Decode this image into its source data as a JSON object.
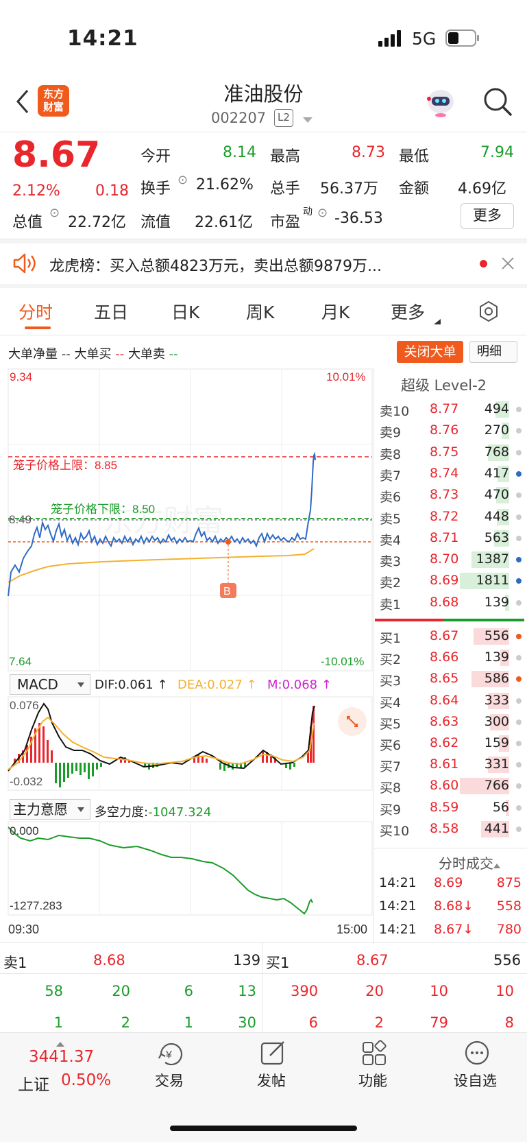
{
  "status": {
    "time": "14:21",
    "network": "5G"
  },
  "header": {
    "logo": "东方\n财富",
    "name": "准油股份",
    "code": "002207",
    "level": "L2"
  },
  "quote": {
    "price": "8.67",
    "change_pct": "2.12%",
    "change": "0.18",
    "open_label": "今开",
    "open": "8.14",
    "high_label": "最高",
    "high": "8.73",
    "low_label": "最低",
    "low": "7.94",
    "turnover_label": "换手",
    "turnover": "21.62%",
    "volume_label": "总手",
    "volume": "56.37万",
    "amount_label": "金额",
    "amount": "4.69亿",
    "mktcap_label": "总值",
    "mktcap": "22.72亿",
    "float_label": "流值",
    "float": "22.61亿",
    "pe_label": "市盈",
    "pe_sup": "动",
    "pe": "-36.53",
    "more": "更多"
  },
  "notice": {
    "text": "龙虎榜：买入总额4823万元，卖出总额9879万..."
  },
  "tabs": [
    "分时",
    "五日",
    "日K",
    "周K",
    "月K",
    "更多"
  ],
  "bigorder": {
    "net": "大单净量",
    "buy": "大单买",
    "sell": "大单卖",
    "close_btn": "关闭大单",
    "detail_btn": "明细"
  },
  "chart": {
    "y_top": "9.34",
    "y_top_pct": "10.01%",
    "y_bottom": "7.64",
    "y_bottom_pct": "-10.01%",
    "y_prev": "8.49",
    "cage_upper": "笼子价格上限：8.85",
    "cage_lower": "笼子价格下限：8.50",
    "marker": "B",
    "watermark": "东方财富",
    "time_start": "09:30",
    "time_end": "15:00"
  },
  "macd": {
    "label": "MACD",
    "dif": "DIF:0.061 ↑",
    "dea": "DEA:0.027 ↑",
    "m": "M:0.068 ↑",
    "top": "0.076",
    "bottom": "-0.032"
  },
  "main_force": {
    "label": "主力意愿",
    "value_label": "多空力度:",
    "value": "-1047.324",
    "top": "0.000",
    "bottom": "-1277.283"
  },
  "level2": {
    "title": "超级 Level-2",
    "asks": [
      {
        "label": "卖10",
        "price": "8.77",
        "vol": "494"
      },
      {
        "label": "卖9",
        "price": "8.76",
        "vol": "270"
      },
      {
        "label": "卖8",
        "price": "8.75",
        "vol": "768"
      },
      {
        "label": "卖7",
        "price": "8.74",
        "vol": "417"
      },
      {
        "label": "卖6",
        "price": "8.73",
        "vol": "470"
      },
      {
        "label": "卖5",
        "price": "8.72",
        "vol": "448"
      },
      {
        "label": "卖4",
        "price": "8.71",
        "vol": "563"
      },
      {
        "label": "卖3",
        "price": "8.70",
        "vol": "1387"
      },
      {
        "label": "卖2",
        "price": "8.69",
        "vol": "1811"
      },
      {
        "label": "卖1",
        "price": "8.68",
        "vol": "139"
      }
    ],
    "bids": [
      {
        "label": "买1",
        "price": "8.67",
        "vol": "556"
      },
      {
        "label": "买2",
        "price": "8.66",
        "vol": "139"
      },
      {
        "label": "买3",
        "price": "8.65",
        "vol": "586"
      },
      {
        "label": "买4",
        "price": "8.64",
        "vol": "333"
      },
      {
        "label": "买5",
        "price": "8.63",
        "vol": "300"
      },
      {
        "label": "买6",
        "price": "8.62",
        "vol": "159"
      },
      {
        "label": "买7",
        "price": "8.61",
        "vol": "331"
      },
      {
        "label": "买8",
        "price": "8.60",
        "vol": "766"
      },
      {
        "label": "买9",
        "price": "8.59",
        "vol": "56"
      },
      {
        "label": "买10",
        "price": "8.58",
        "vol": "441"
      }
    ],
    "trades_title": "分时成交",
    "trades": [
      {
        "time": "14:21",
        "price": "8.69",
        "vol": "875"
      },
      {
        "time": "14:21",
        "price": "8.68↓",
        "vol": "558"
      },
      {
        "time": "14:21",
        "price": "8.67↓",
        "vol": "780"
      }
    ]
  },
  "queue": {
    "ask_label": "卖1",
    "ask_price": "8.68",
    "ask_vol": "139",
    "bid_label": "买1",
    "bid_price": "8.67",
    "bid_vol": "556",
    "ask_rows": [
      [
        "58",
        "20",
        "6",
        "13"
      ],
      [
        "1",
        "2",
        "1",
        "30"
      ]
    ],
    "bid_rows": [
      [
        "390",
        "20",
        "10",
        "10"
      ],
      [
        "6",
        "2",
        "79",
        "8"
      ]
    ]
  },
  "bottom": {
    "index_value": "3441.37",
    "index_name": "上证",
    "index_pct": "0.50%",
    "trade": "交易",
    "post": "发帖",
    "func": "功能",
    "watch": "设自选"
  }
}
